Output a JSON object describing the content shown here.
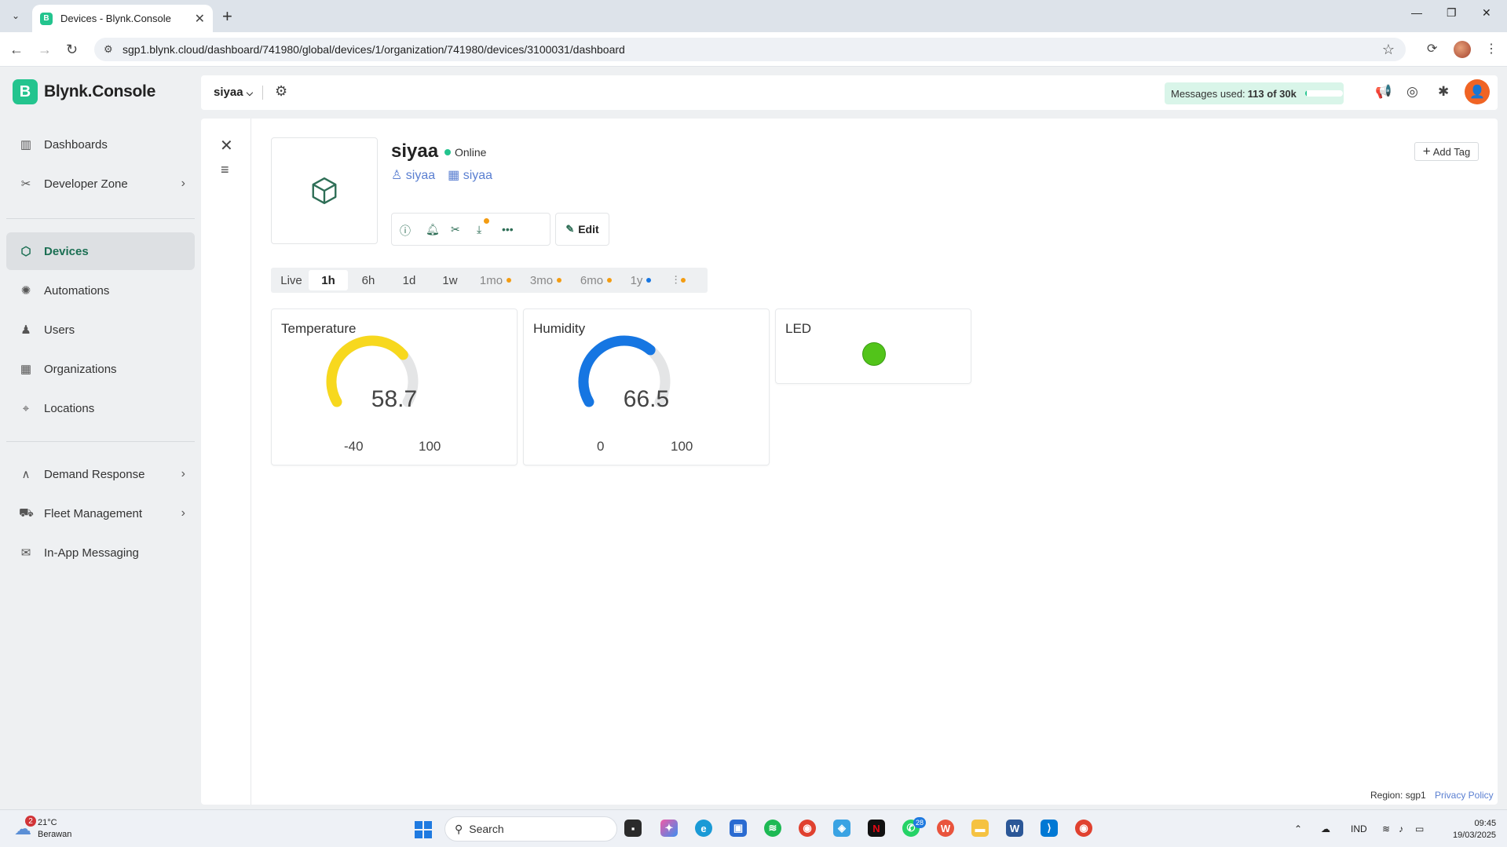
{
  "browser": {
    "tab_title": "Devices - Blynk.Console",
    "tab_favicon": "B",
    "url": "sgp1.blynk.cloud/dashboard/741980/global/devices/1/organization/741980/devices/3100031/dashboard"
  },
  "app": {
    "logo_letter": "B",
    "name": "Blynk.Console",
    "org_name": "siyaa",
    "messages_label": "Messages used:",
    "messages_value": "113 of 30k",
    "messages_fraction": 0.004
  },
  "sidebar": {
    "items": [
      {
        "label": "Dashboards",
        "icon": "chart-icon"
      },
      {
        "label": "Developer Zone",
        "icon": "wrench-icon"
      },
      {
        "label": "Devices",
        "icon": "cube-icon"
      },
      {
        "label": "Automations",
        "icon": "automation-icon"
      },
      {
        "label": "Users",
        "icon": "users-icon"
      },
      {
        "label": "Organizations",
        "icon": "building-icon"
      },
      {
        "label": "Locations",
        "icon": "pin-icon"
      },
      {
        "label": "Demand Response",
        "icon": "demand-icon"
      },
      {
        "label": "Fleet Management",
        "icon": "truck-icon"
      },
      {
        "label": "In-App Messaging",
        "icon": "message-icon"
      }
    ]
  },
  "device": {
    "name": "siyaa",
    "status": "Online",
    "owner": "siyaa",
    "organization": "siyaa",
    "edit_label": "Edit",
    "add_tag_label": "Add Tag"
  },
  "time_ranges": [
    "Live",
    "1h",
    "6h",
    "1d",
    "1w",
    "1mo",
    "3mo",
    "6mo",
    "1y"
  ],
  "widgets": {
    "temperature": {
      "title": "Temperature",
      "value": "58.7",
      "min": "-40",
      "max": "100",
      "color": "#f7d81e"
    },
    "humidity": {
      "title": "Humidity",
      "value": "66.5",
      "min": "0",
      "max": "100",
      "color": "#1676e2"
    },
    "led": {
      "title": "LED",
      "color": "#52c41a"
    }
  },
  "footer": {
    "region": "Region: sgp1",
    "privacy": "Privacy Policy"
  },
  "taskbar": {
    "weather_temp": "21°C",
    "weather_desc": "Berawan",
    "weather_badge": "2",
    "search_placeholder": "Search",
    "whatsapp_badge": "28",
    "language": "IND",
    "time": "09:45",
    "date": "19/03/2025"
  }
}
